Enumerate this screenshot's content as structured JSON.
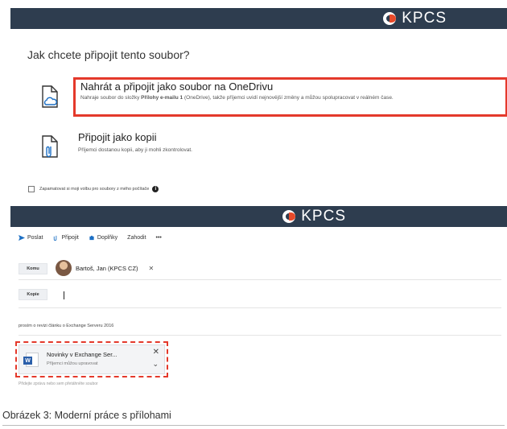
{
  "brand": {
    "logo_text": "KPCS",
    "accent": "#e84a2a",
    "banner_bg": "#2e3d4f"
  },
  "dialog": {
    "title": "Jak chcete připojit tento soubor?",
    "option1": {
      "icon": "cloud-file-icon",
      "title": "Nahrát a připojit jako soubor na OneDrivu",
      "desc_pre": "Nahraje soubor do složky ",
      "desc_bold": "Přílohy e-mailu 1",
      "desc_post": " (OneDrive), takže příjemci uvidí nejnovější změny a můžou spolupracovat v reálném čase."
    },
    "option2": {
      "icon": "attachment-file-icon",
      "title": "Připojit jako kopii",
      "desc": "Příjemci dostanou kopii, aby ji mohli zkontrolovat."
    },
    "remember_label": "Zapamatovat si moji volbu pro soubory z mého počítače",
    "highlight_color": "#e4392b"
  },
  "compose": {
    "toolbar": {
      "send": "Poslat",
      "attach": "Připojit",
      "addins": "Doplňky",
      "discard": "Zahodit",
      "more": "•••"
    },
    "to_label": "Komu",
    "recipient": "Bartoš, Jan (KPCS CZ)",
    "cc_label": "Kopie",
    "subject": "prosím o revizi článku o Exchange Serveru 2016",
    "attachment": {
      "name": "Novinky v Exchange Ser...",
      "status": "Příjemci můžou upravovat"
    },
    "body_hint": "Přidejte zprávu nebo sem přetáhněte soubor"
  },
  "caption": "Obrázek 3: Moderní práce s přílohami"
}
